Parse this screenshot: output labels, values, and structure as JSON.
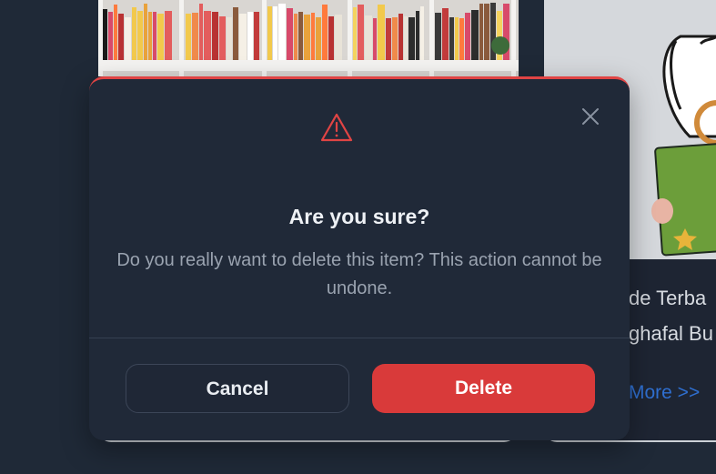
{
  "modal": {
    "title": "Are you sure?",
    "message": "Do you really want to delete this item? This action cannot be undone.",
    "cancel_label": "Cancel",
    "delete_label": "Delete",
    "icon": "warning-triangle-icon",
    "close_icon": "close-icon",
    "accent_color": "#e04444"
  },
  "background": {
    "right_card": {
      "line1": "de Terba",
      "line2": "ghafal Bu",
      "link": "More >>"
    }
  }
}
